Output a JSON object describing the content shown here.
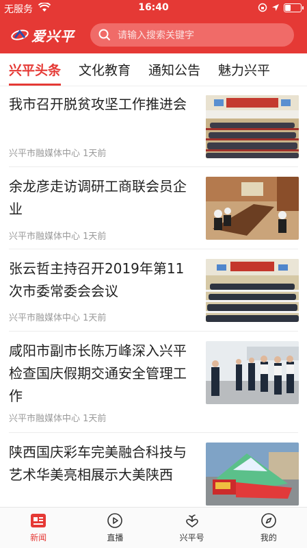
{
  "status_bar": {
    "carrier": "无服务",
    "time": "16:40",
    "battery_level": 0.35
  },
  "header": {
    "brand": "爱兴平",
    "search_placeholder": "请输入搜索关键字"
  },
  "tabs": [
    {
      "label": "兴平头条",
      "active": true
    },
    {
      "label": "文化教育",
      "active": false
    },
    {
      "label": "通知公告",
      "active": false
    },
    {
      "label": "魅力兴平",
      "active": false
    }
  ],
  "news": [
    {
      "title": "我市召开脱贫攻坚工作推进会",
      "source": "兴平市融媒体中心",
      "time": "1天前",
      "image": "meeting-hall-photo"
    },
    {
      "title": "余龙彦走访调研工商联会员企业",
      "source": "兴平市融媒体中心",
      "time": "1天前",
      "image": "meeting-room-photo"
    },
    {
      "title": "张云哲主持召开2019年第11次市委常委会会议",
      "source": "兴平市融媒体中心",
      "time": "1天前",
      "image": "conference-photo"
    },
    {
      "title": "咸阳市副市长陈万峰深入兴平检查国庆假期交通安全管理工作",
      "source": "兴平市融媒体中心",
      "time": "1天前",
      "image": "traffic-inspection-photo"
    },
    {
      "title": "陕西国庆彩车完美融合科技与艺术华美亮相展示大美陕西",
      "source": "",
      "time": "",
      "image": "parade-float-photo"
    }
  ],
  "bottom_nav": [
    {
      "label": "新闻",
      "icon": "news-icon",
      "active": true
    },
    {
      "label": "直播",
      "icon": "play-icon",
      "active": false
    },
    {
      "label": "兴平号",
      "icon": "heart-sprout-icon",
      "active": false
    },
    {
      "label": "我的",
      "icon": "compass-icon",
      "active": false
    }
  ],
  "colors": {
    "brand_red": "#e53935",
    "meta_gray": "#9a9a9a"
  }
}
